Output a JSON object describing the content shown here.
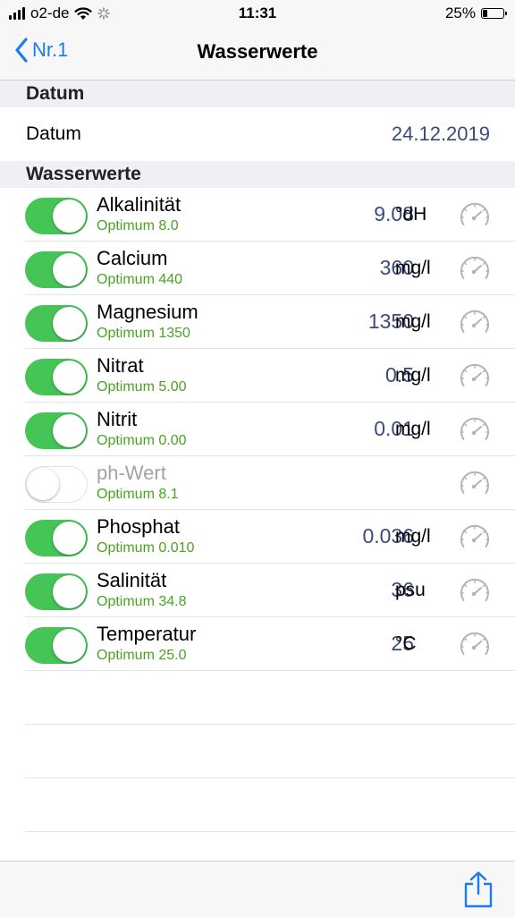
{
  "status_bar": {
    "carrier": "o2-de",
    "time": "11:31",
    "battery_percent": "25%",
    "battery_level": 0.25
  },
  "nav": {
    "back_label": "Nr.1",
    "title": "Wasserwerte"
  },
  "date_section": {
    "header": "Datum",
    "label": "Datum",
    "value": "24.12.2019"
  },
  "values_section": {
    "header": "Wasserwerte",
    "items": [
      {
        "name": "Alkalinität",
        "optimum": "Optimum 8.0",
        "value": "9.08",
        "unit": "°dH",
        "enabled": true
      },
      {
        "name": "Calcium",
        "optimum": "Optimum 440",
        "value": "360",
        "unit": "mg/l",
        "enabled": true
      },
      {
        "name": "Magnesium",
        "optimum": "Optimum 1350",
        "value": "1350",
        "unit": "mg/l",
        "enabled": true
      },
      {
        "name": "Nitrat",
        "optimum": "Optimum 5.00",
        "value": "0.5",
        "unit": "mg/l",
        "enabled": true
      },
      {
        "name": "Nitrit",
        "optimum": "Optimum 0.00",
        "value": "0.01",
        "unit": "mg/l",
        "enabled": true
      },
      {
        "name": "ph-Wert",
        "optimum": "Optimum 8.1",
        "value": "",
        "unit": "",
        "enabled": false
      },
      {
        "name": "Phosphat",
        "optimum": "Optimum 0.010",
        "value": "0.036",
        "unit": "mg/l",
        "enabled": true
      },
      {
        "name": "Salinität",
        "optimum": "Optimum 34.8",
        "value": "36",
        "unit": "psu",
        "enabled": true
      },
      {
        "name": "Temperatur",
        "optimum": "Optimum 25.0",
        "value": "25",
        "unit": "°C",
        "enabled": true
      }
    ]
  },
  "icons": {
    "back": "chevron-left-icon",
    "gauge": "gauge-icon",
    "share": "share-icon",
    "wifi": "wifi-icon",
    "signal": "signal-icon",
    "battery": "battery-icon"
  },
  "colors": {
    "accent": "#1a7cf5",
    "toggle_on": "#44c556",
    "value_text": "#3c4a7c",
    "optimum_text": "#4aa321",
    "section_bg": "#efeff4"
  }
}
